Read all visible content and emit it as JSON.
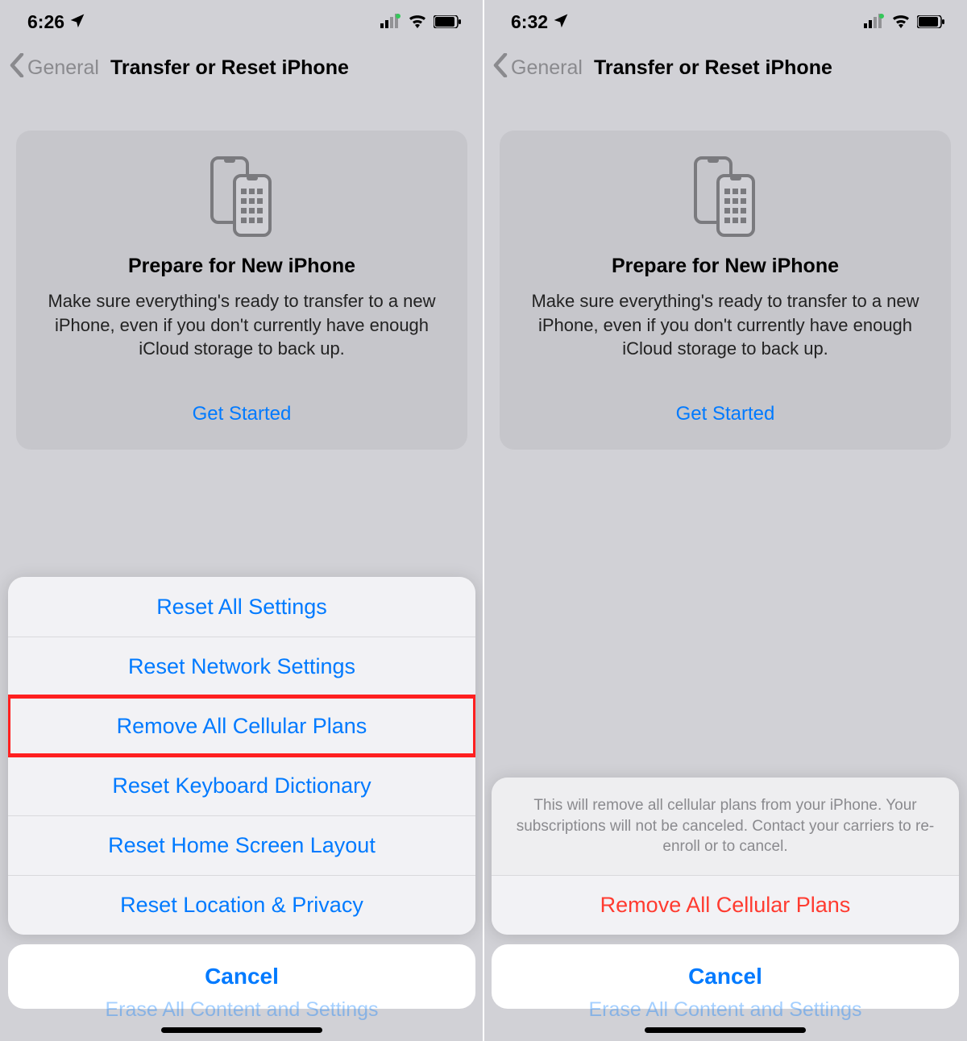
{
  "left": {
    "status": {
      "time": "6:26"
    },
    "nav": {
      "back": "General",
      "title": "Transfer or Reset iPhone"
    },
    "card": {
      "title": "Prepare for New iPhone",
      "desc": "Make sure everything's ready to transfer to a new iPhone, even if you don't currently have enough iCloud storage to back up.",
      "link": "Get Started"
    },
    "sheet": {
      "items": [
        "Reset All Settings",
        "Reset Network Settings",
        "Remove All Cellular Plans",
        "Reset Keyboard Dictionary",
        "Reset Home Screen Layout",
        "Reset Location & Privacy"
      ],
      "highlight_index": 2,
      "cancel": "Cancel"
    }
  },
  "right": {
    "status": {
      "time": "6:32"
    },
    "nav": {
      "back": "General",
      "title": "Transfer or Reset iPhone"
    },
    "card": {
      "title": "Prepare for New iPhone",
      "desc": "Make sure everything's ready to transfer to a new iPhone, even if you don't currently have enough iCloud storage to back up.",
      "link": "Get Started"
    },
    "confirm": {
      "message": "This will remove all cellular plans from your iPhone. Your subscriptions will not be canceled. Contact your carriers to re-enroll or to cancel.",
      "action": "Remove All Cellular Plans",
      "cancel": "Cancel"
    }
  }
}
